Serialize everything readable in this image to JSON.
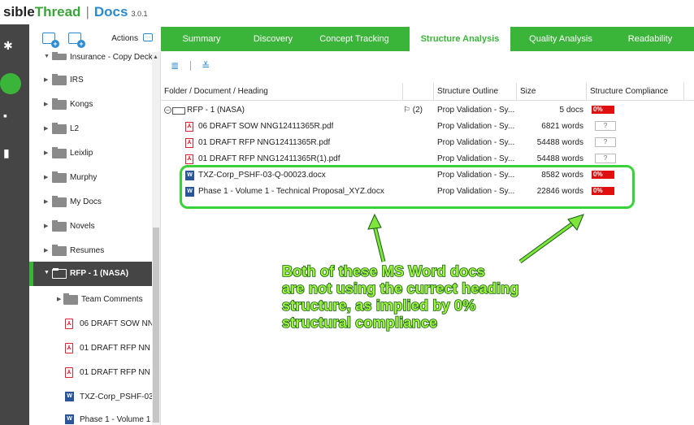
{
  "brand": {
    "part1": "sible",
    "part2": "Thread",
    "sep": "|",
    "docs": "Docs",
    "version": "3.0.1"
  },
  "rail": {
    "icons": [
      "wrench-icon",
      "home-icon",
      "document-icon",
      "chart-icon"
    ]
  },
  "tree": {
    "actions_label": "Actions",
    "nodes": [
      {
        "label": "Insurance - Copy Deck",
        "kind": "folder"
      },
      {
        "label": "IRS",
        "kind": "folder"
      },
      {
        "label": "Kongs",
        "kind": "folder"
      },
      {
        "label": "L2",
        "kind": "folder"
      },
      {
        "label": "Leixlip",
        "kind": "folder"
      },
      {
        "label": "Murphy",
        "kind": "folder"
      },
      {
        "label": "My Docs",
        "kind": "folder"
      },
      {
        "label": "Novels",
        "kind": "folder"
      },
      {
        "label": "Resumes",
        "kind": "folder"
      },
      {
        "label": "RFP - 1 (NASA)",
        "kind": "folder-selected"
      },
      {
        "label": "Team Comments",
        "kind": "subfolder"
      },
      {
        "label": "06 DRAFT SOW NN",
        "kind": "pdf"
      },
      {
        "label": "01 DRAFT RFP NN",
        "kind": "pdf"
      },
      {
        "label": "01 DRAFT RFP NN",
        "kind": "pdf"
      },
      {
        "label": "TXZ-Corp_PSHF-03",
        "kind": "word"
      },
      {
        "label": "Phase 1 - Volume 1",
        "kind": "word"
      }
    ]
  },
  "tabs": [
    {
      "label": "Summary",
      "active": false
    },
    {
      "label": "Discovery",
      "active": false
    },
    {
      "label": "Concept Tracking",
      "active": false
    },
    {
      "label": "Structure Analysis",
      "active": true
    },
    {
      "label": "Quality Analysis",
      "active": false
    },
    {
      "label": "Readability",
      "active": false
    }
  ],
  "grid": {
    "headers": {
      "name": "Folder / Document / Heading",
      "outline": "Structure Outline",
      "size": "Size",
      "compliance": "Structure Compliance"
    },
    "rows": [
      {
        "name": "RFP - 1 (NASA)",
        "icon": "folder",
        "comments": "(2)",
        "outline": "Prop Validation - Sy...",
        "size": "5 docs",
        "compliance": "0%",
        "comp_kind": "red"
      },
      {
        "name": "06 DRAFT SOW NNG12411365R.pdf",
        "icon": "pdf",
        "comments": "",
        "outline": "Prop Validation - Sy...",
        "size": "6821 words",
        "compliance": "?",
        "comp_kind": "q"
      },
      {
        "name": "01 DRAFT RFP NNG12411365R.pdf",
        "icon": "pdf",
        "comments": "",
        "outline": "Prop Validation - Sy...",
        "size": "54488 words",
        "compliance": "?",
        "comp_kind": "q"
      },
      {
        "name": "01 DRAFT RFP NNG12411365R(1).pdf",
        "icon": "pdf",
        "comments": "",
        "outline": "Prop Validation - Sy...",
        "size": "54488 words",
        "compliance": "?",
        "comp_kind": "q"
      },
      {
        "name": "TXZ-Corp_PSHF-03-Q-00023.docx",
        "icon": "word",
        "comments": "",
        "outline": "Prop Validation - Sy...",
        "size": "8582 words",
        "compliance": "0%",
        "comp_kind": "red"
      },
      {
        "name": "Phase 1 - Volume 1 - Technical Proposal_XYZ.docx",
        "icon": "word",
        "comments": "",
        "outline": "Prop Validation - Sy...",
        "size": "22846 words",
        "compliance": "0%",
        "comp_kind": "red"
      }
    ]
  },
  "annotation": {
    "text": "Both of these MS Word docs\nare not using the currect heading\nstructure, as implied by 0%\nstructural compliance",
    "color": "#9bf53a"
  },
  "colors": {
    "accent_green": "#3ab539",
    "brand_blue": "#2a8bd0",
    "compliance_red": "#e01010"
  }
}
